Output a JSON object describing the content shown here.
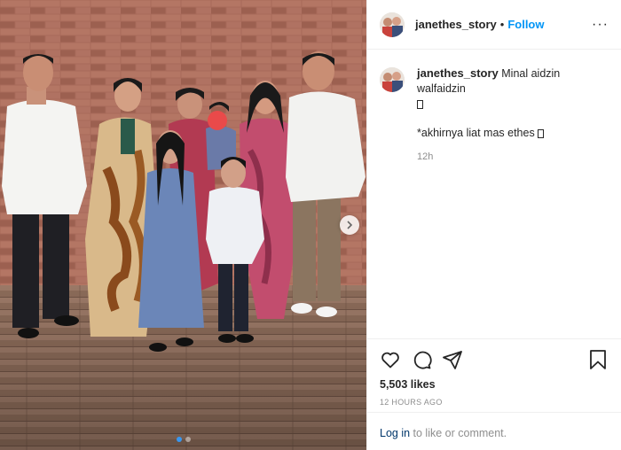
{
  "header": {
    "username": "janethes_story",
    "separator": "•",
    "follow_label": "Follow",
    "more_icon": "more-options-icon",
    "more_label": "···"
  },
  "caption": {
    "username": "janethes_story",
    "line1": "Minal aidzin walfaidzin",
    "line2": "*akhirnya liat mas ethes",
    "time": "12h"
  },
  "actions": {
    "icons": [
      "heart-icon",
      "comment-icon",
      "share-icon",
      "bookmark-icon"
    ]
  },
  "likes": "5,503 likes",
  "posted_ago": "12 HOURS AGO",
  "login_prompt": {
    "link": "Log in",
    "text": " to like or comment."
  },
  "carousel": {
    "slide_count": 2,
    "active_slide": 1
  },
  "colors": {
    "follow_blue": "#0095f6",
    "link_dark": "#00376b",
    "muted_gray": "#8e8e8e",
    "dot_active": "#3897f0"
  }
}
